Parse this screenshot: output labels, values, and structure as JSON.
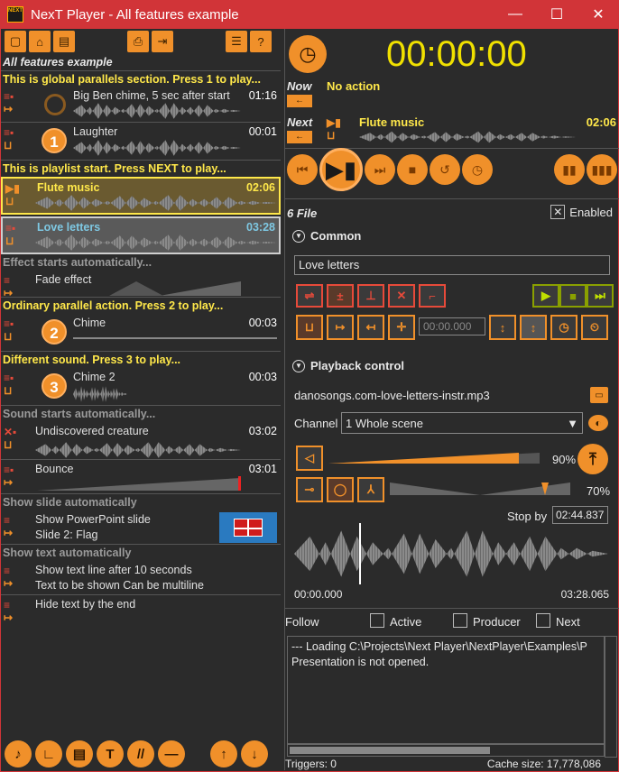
{
  "window": {
    "app_icon": "NEXT",
    "title": "NexT Player - All features example",
    "minimize": "—",
    "maximize": "☐",
    "close": "✕"
  },
  "playlist": {
    "header": "All features example",
    "sections": {
      "global": "This is global parallels section. Press 1 to play...",
      "start": "This is playlist start. Press NEXT to play...",
      "effect": "Effect starts automatically...",
      "ordinary": "Ordinary parallel action. Press 2 to play...",
      "different": "Different sound. Press 3 to play...",
      "sound_auto": "Sound starts automatically...",
      "slide_auto": "Show slide automatically",
      "text_auto": "Show text automatically"
    },
    "items": {
      "bigben": {
        "name": "Big Ben chime, 5 sec after start",
        "dur": "01:16"
      },
      "laughter": {
        "name": "Laughter",
        "dur": "00:01",
        "key": "1"
      },
      "flute": {
        "name": "Flute music",
        "dur": "02:06"
      },
      "love": {
        "name": "Love letters",
        "dur": "03:28"
      },
      "fade": {
        "name": "Fade effect"
      },
      "chime": {
        "name": "Chime",
        "dur": "00:03",
        "key": "2"
      },
      "chime2": {
        "name": "Chime 2",
        "dur": "00:03",
        "key": "3"
      },
      "creature": {
        "name": "Undiscovered creature",
        "dur": "03:02"
      },
      "bounce": {
        "name": "Bounce",
        "dur": "03:01"
      },
      "ppt": {
        "name": "Show PowerPoint slide",
        "sub": "Slide 2: Flag"
      },
      "textline": {
        "name": "Show text line after 10 seconds",
        "sub": "Text to be shown Can be multiline"
      },
      "hidetext": {
        "name": "Hide text by the end"
      }
    }
  },
  "player": {
    "time": "00:00:00",
    "now_label": "Now",
    "now_value": "No action",
    "next_label": "Next",
    "next_value": "Flute music",
    "next_dur": "02:06"
  },
  "file_panel": {
    "title": "6 File",
    "enabled_label": "Enabled",
    "common_header": "Common",
    "item_name": "Love letters",
    "time_input": "00:00.000",
    "playback_header": "Playback control",
    "filename": "danosongs.com-love-letters-instr.mp3",
    "channel_label": "Channel",
    "channel_value": "1 Whole scene",
    "volume_pct": "90%",
    "volume_level": 0.9,
    "pan_pct": "70%",
    "stop_by_label": "Stop by",
    "stop_by_value": "02:44.837",
    "start_time": "00:00.000",
    "end_time": "03:28.065"
  },
  "follow": {
    "label": "Follow",
    "active": "Active",
    "producer": "Producer",
    "next": "Next"
  },
  "log": {
    "line1": "--- Loading C:\\Projects\\Next Player\\NextPlayer\\Examples\\P",
    "line2": "Presentation is not opened."
  },
  "status": {
    "triggers": "Triggers: 0",
    "cache": "Cache size: 17,778,086"
  },
  "colors": {
    "accent": "#f0902a",
    "highlight": "#ffe84a",
    "title_bar": "#d13438"
  }
}
